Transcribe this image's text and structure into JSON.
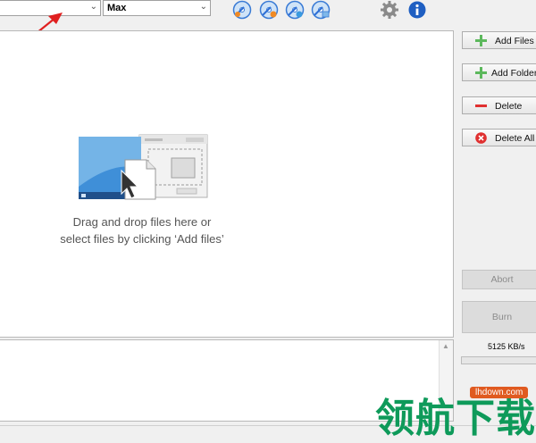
{
  "toolbar": {
    "combo_left": {
      "value": ""
    },
    "combo_speed": {
      "value": "Max"
    },
    "icons": [
      "burn-disc-icon",
      "disc-add-icon",
      "disc-copy-icon",
      "disc-erase-icon"
    ],
    "settings_icon": "gear-icon",
    "info_icon": "info-icon"
  },
  "drop_area": {
    "line1": "Drag and drop files here or",
    "line2": "select files by clicking ‘Add files’"
  },
  "side_buttons": {
    "add_files": "Add Files",
    "add_folders": "Add Folders",
    "delete": "Delete",
    "delete_all": "Delete All",
    "abort": "Abort",
    "burn": "Burn"
  },
  "status": {
    "speed": "5125 KB/s",
    "progress": 0
  },
  "watermark": {
    "text": "领航下载",
    "url": "lhdown.com"
  },
  "colors": {
    "accent": "#2d6fd6",
    "add_green": "#5cb85c",
    "delete_red": "#e03030",
    "watermark_green": "#0e9a5a",
    "annotation_red": "#e02020"
  }
}
